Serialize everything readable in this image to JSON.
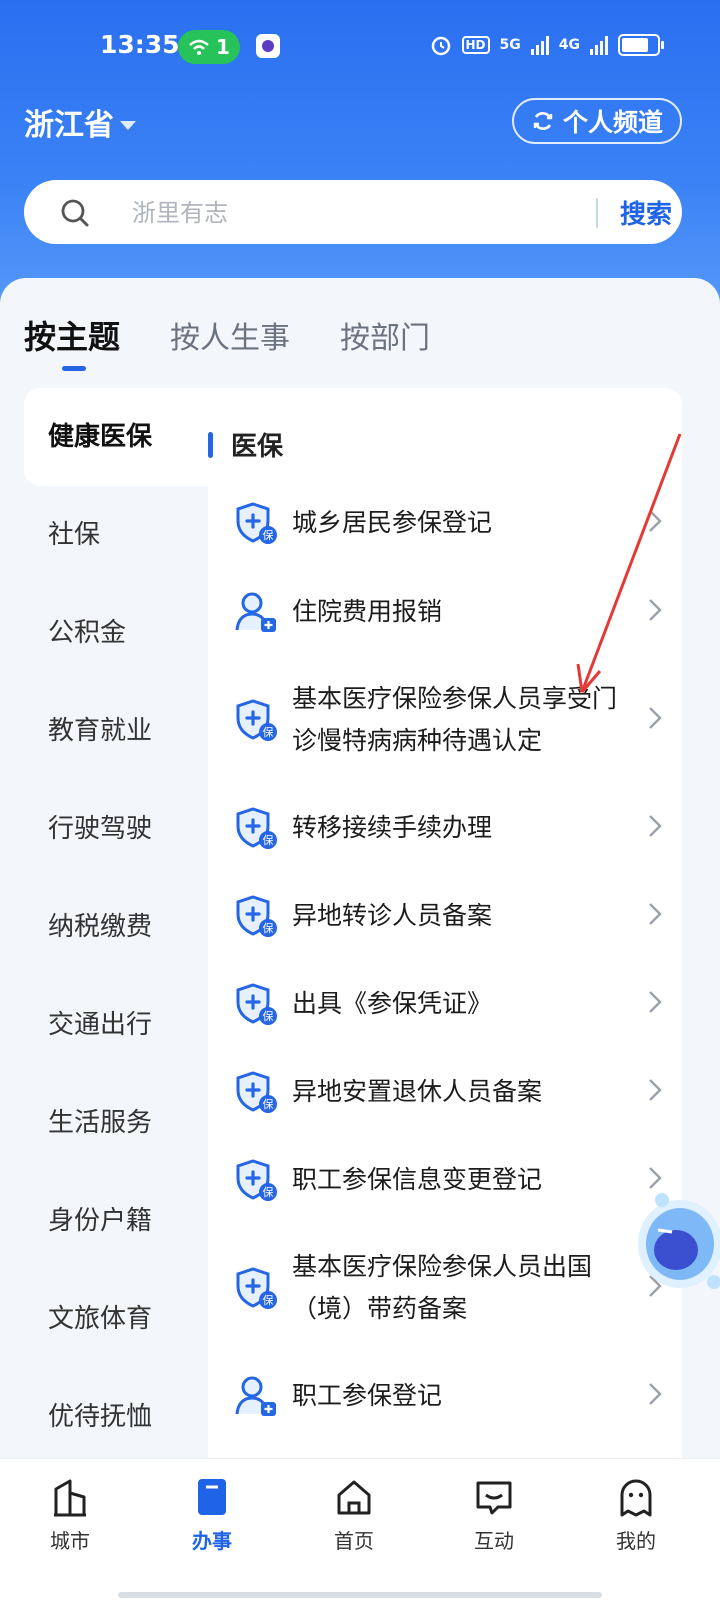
{
  "status_bar": {
    "time": "13:35",
    "wifi_count": "1",
    "net1": "5G",
    "net2": "4G",
    "hd": "HD"
  },
  "header": {
    "province": "浙江省",
    "channel_label": "个人频道"
  },
  "search": {
    "placeholder": "浙里有志",
    "button_label": "搜索"
  },
  "tabs": [
    {
      "label": "按主题",
      "active": true
    },
    {
      "label": "按人生事",
      "active": false
    },
    {
      "label": "按部门",
      "active": false
    }
  ],
  "sidebar": {
    "items": [
      {
        "label": "健康医保",
        "active": true
      },
      {
        "label": "社保"
      },
      {
        "label": "公积金"
      },
      {
        "label": "教育就业"
      },
      {
        "label": "行驶驾驶"
      },
      {
        "label": "纳税缴费"
      },
      {
        "label": "交通出行"
      },
      {
        "label": "生活服务"
      },
      {
        "label": "身份户籍"
      },
      {
        "label": "文旅体育"
      },
      {
        "label": "优待抚恤"
      }
    ]
  },
  "section": {
    "title": "医保",
    "items": [
      {
        "label": "城乡居民参保登记",
        "icon": "shield-insurance-icon"
      },
      {
        "label": "住院费用报销",
        "icon": "person-medical-icon"
      },
      {
        "label": "基本医疗保险参保人员享受门诊慢特病病种待遇认定",
        "icon": "shield-insurance-icon"
      },
      {
        "label": "转移接续手续办理",
        "icon": "shield-insurance-icon"
      },
      {
        "label": "异地转诊人员备案",
        "icon": "shield-insurance-icon"
      },
      {
        "label": "出具《参保凭证》",
        "icon": "shield-insurance-icon"
      },
      {
        "label": "异地安置退休人员备案",
        "icon": "shield-insurance-icon"
      },
      {
        "label": "职工参保信息变更登记",
        "icon": "shield-insurance-icon"
      },
      {
        "label": "基本医疗保险参保人员出国（境）带药备案",
        "icon": "shield-insurance-icon"
      },
      {
        "label": "职工参保登记",
        "icon": "person-medical-icon"
      }
    ]
  },
  "bottom_nav": [
    {
      "label": "城市",
      "icon": "city-icon"
    },
    {
      "label": "办事",
      "icon": "affairs-icon",
      "active": true
    },
    {
      "label": "首页",
      "icon": "home-icon"
    },
    {
      "label": "互动",
      "icon": "chat-icon"
    },
    {
      "label": "我的",
      "icon": "profile-icon"
    }
  ],
  "colors": {
    "primary": "#1f63e6",
    "header_gradient_top": "#2a6ff0",
    "annotation_arrow": "#e53935"
  }
}
